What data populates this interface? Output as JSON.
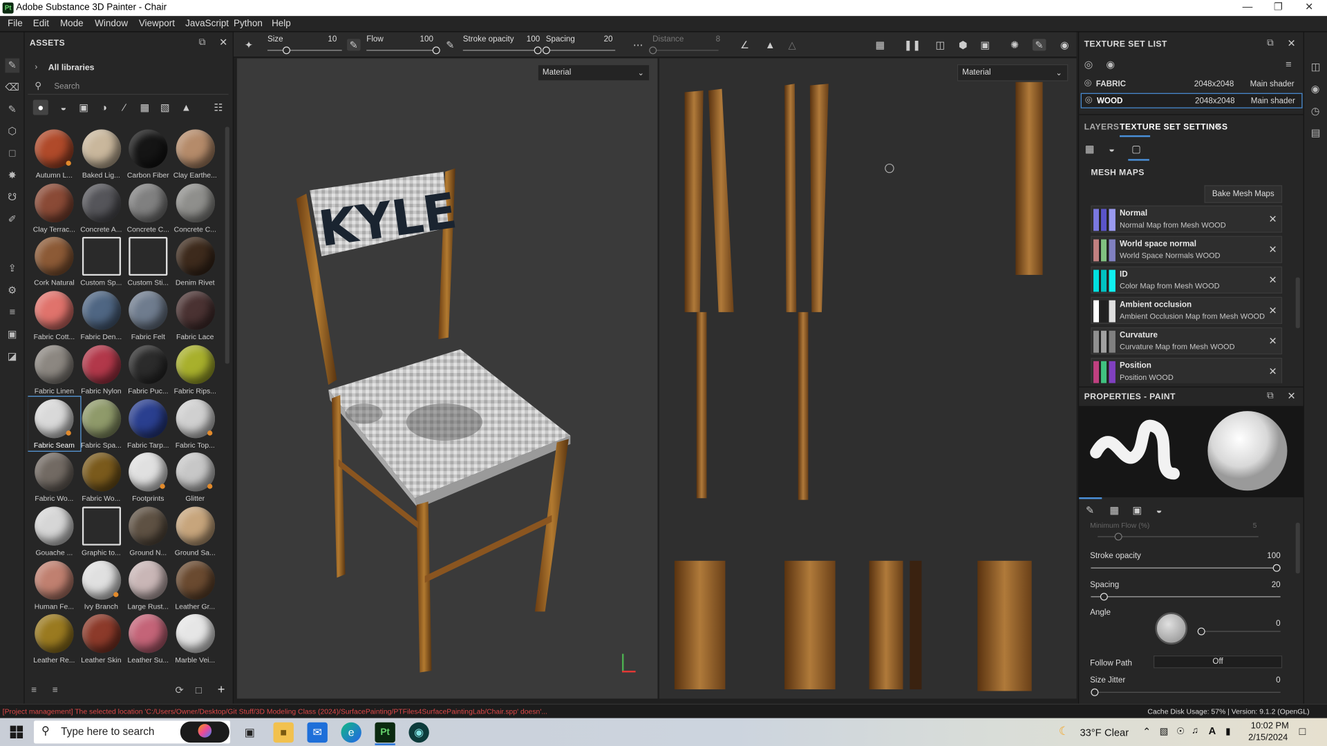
{
  "window": {
    "title": "Adobe Substance 3D Painter - Chair",
    "logo": "Pt"
  },
  "menu": [
    "File",
    "Edit",
    "Mode",
    "Window",
    "Viewport",
    "JavaScript",
    "Python",
    "Help"
  ],
  "assets": {
    "title": "ASSETS",
    "breadcrumb": "All libraries",
    "search_placeholder": "Search",
    "items": [
      {
        "label": "Autumn L...",
        "color": "#b04a2a",
        "dot": true
      },
      {
        "label": "Baked Lig...",
        "color": "#c9b79c"
      },
      {
        "label": "Carbon Fiber",
        "color": "#151515"
      },
      {
        "label": "Clay Earthe...",
        "color": "#b58b6a"
      },
      {
        "label": "Clay Terrac...",
        "color": "#8a4a36"
      },
      {
        "label": "Concrete A...",
        "color": "#55555a"
      },
      {
        "label": "Concrete C...",
        "color": "#808080"
      },
      {
        "label": "Concrete C...",
        "color": "#8f8f8c"
      },
      {
        "label": "Cork Natural",
        "color": "#8c5a36"
      },
      {
        "label": "Custom Sp...",
        "color": "#2a2a2a",
        "icon": true
      },
      {
        "label": "Custom Sti...",
        "color": "#2a2a2a",
        "icon": true
      },
      {
        "label": "Denim Rivet",
        "color": "#3d2a1c"
      },
      {
        "label": "Fabric Cott...",
        "color": "#e0736c"
      },
      {
        "label": "Fabric Den...",
        "color": "#4f6683"
      },
      {
        "label": "Fabric Felt",
        "color": "#6f7c8e"
      },
      {
        "label": "Fabric Lace",
        "color": "#4a3232"
      },
      {
        "label": "Fabric Linen",
        "color": "#8c8781"
      },
      {
        "label": "Fabric Nylon",
        "color": "#b2384a"
      },
      {
        "label": "Fabric Puc...",
        "color": "#2b2b2b"
      },
      {
        "label": "Fabric Rips...",
        "color": "#a8b02c"
      },
      {
        "label": "Fabric Seam",
        "color": "#d9d9d9",
        "dot": true,
        "selected": true
      },
      {
        "label": "Fabric Spa...",
        "color": "#8f9a6a"
      },
      {
        "label": "Fabric Tarp...",
        "color": "#2a3f8f"
      },
      {
        "label": "Fabric Top...",
        "color": "#d0d0d0",
        "dot": true
      },
      {
        "label": "Fabric Wo...",
        "color": "#726a63"
      },
      {
        "label": "Fabric Wo...",
        "color": "#7a5a1c"
      },
      {
        "label": "Footprints",
        "color": "#e0e0e0",
        "dot": true
      },
      {
        "label": "Glitter",
        "color": "#c7c7c7",
        "dot": true
      },
      {
        "label": "Gouache ...",
        "color": "#d6d6d6"
      },
      {
        "label": "Graphic to...",
        "color": "#2a2a2a",
        "icon": true
      },
      {
        "label": "Ground N...",
        "color": "#5e5143"
      },
      {
        "label": "Ground Sa...",
        "color": "#c7a57c"
      },
      {
        "label": "Human Fe...",
        "color": "#c08070"
      },
      {
        "label": "Ivy Branch",
        "color": "#e0e0e0",
        "dot": true
      },
      {
        "label": "Large Rust...",
        "color": "#c9b6b6"
      },
      {
        "label": "Leather Gr...",
        "color": "#6a4a30"
      },
      {
        "label": "Leather Re...",
        "color": "#9a7a20"
      },
      {
        "label": "Leather Skin",
        "color": "#8c3a2a"
      },
      {
        "label": "Leather Su...",
        "color": "#c46478"
      },
      {
        "label": "Marble Vei...",
        "color": "#e6e6e6"
      }
    ]
  },
  "toolbar": {
    "size_label": "Size",
    "size_value": "10",
    "flow_label": "Flow",
    "flow_value": "100",
    "opacity_label": "Stroke opacity",
    "opacity_value": "100",
    "spacing_label": "Spacing",
    "spacing_value": "20",
    "distance_label": "Distance",
    "distance_value": "8",
    "size_pct": 0.25,
    "flow_pct": 1.0,
    "opacity_pct": 1.0,
    "spacing_pct": 0.0,
    "distance_pct": 0.0
  },
  "viewport3d": {
    "dropdown": "Material",
    "chair_text": "KYLE"
  },
  "viewport2d": {
    "dropdown": "Material"
  },
  "texture_set_list": {
    "title": "TEXTURE SET LIST",
    "rows": [
      {
        "name": "FABRIC",
        "resolution": "2048x2048",
        "shader": "Main shader"
      },
      {
        "name": "WOOD",
        "resolution": "2048x2048",
        "shader": "Main shader"
      }
    ]
  },
  "tabs": {
    "layers": "LAYERS",
    "settings": "TEXTURE SET SETTINGS"
  },
  "mesh_maps": {
    "title": "MESH MAPS",
    "bake_button": "Bake Mesh Maps",
    "items": [
      {
        "name": "Normal",
        "desc": "Normal Map from Mesh WOOD",
        "colors": [
          "#7a78e0",
          "#5a54c8",
          "#9a9af0"
        ]
      },
      {
        "name": "World space normal",
        "desc": "World Space Normals WOOD",
        "colors": [
          "#c08080",
          "#80c080",
          "#8080c0"
        ]
      },
      {
        "name": "ID",
        "desc": "Color Map from Mesh WOOD",
        "colors": [
          "#00e0e0",
          "#00c0c0",
          "#10f0f0"
        ]
      },
      {
        "name": "Ambient occlusion",
        "desc": "Ambient Occlusion Map from Mesh WOOD",
        "colors": [
          "#ffffff",
          "#202020",
          "#e0e0e0"
        ]
      },
      {
        "name": "Curvature",
        "desc": "Curvature Map from Mesh WOOD",
        "colors": [
          "#909090",
          "#a0a0a0",
          "#808080"
        ]
      },
      {
        "name": "Position",
        "desc": "Position WOOD",
        "colors": [
          "#c04080",
          "#40c080",
          "#8040c0"
        ]
      }
    ]
  },
  "properties": {
    "title": "PROPERTIES - PAINT",
    "min_flow_label": "Minimum Flow (%)",
    "min_flow_value": "5",
    "stroke_opacity_label": "Stroke opacity",
    "stroke_opacity_value": "100",
    "spacing_label": "Spacing",
    "spacing_value": "20",
    "angle_label": "Angle",
    "angle_value": "0",
    "follow_path_label": "Follow Path",
    "follow_path_value": "Off",
    "size_jitter_label": "Size Jitter",
    "size_jitter_value": "0"
  },
  "status": {
    "message": "[Project management] The selected location 'C:/Users/Owner/Desktop/Git Stuff/3D Modeling Class (2024)/SurfacePainting/PTFiles4SurfacePaintingLab/Chair.spp' doesn'...",
    "cache": "Cache Disk Usage:  57% | Version: 9.1.2 (OpenGL)"
  },
  "taskbar": {
    "search_placeholder": "Type here to search",
    "weather_temp": "33°F",
    "weather_cond": "Clear",
    "time": "10:02 PM",
    "date": "2/15/2024"
  }
}
